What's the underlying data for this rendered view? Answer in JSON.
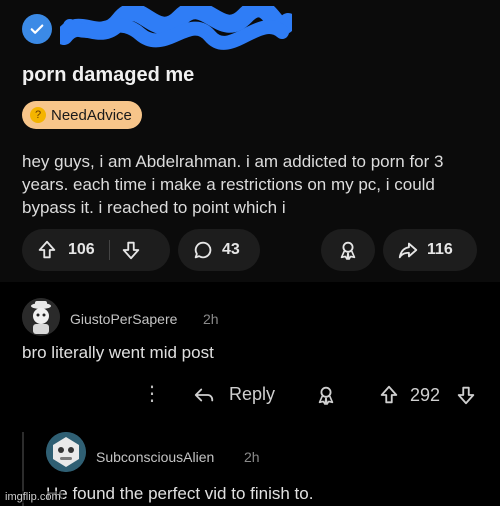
{
  "post": {
    "title": "porn damaged me",
    "flair": "NeedAdvice",
    "body": "hey guys, i am Abdelrahman. i am addicted to porn for 3 years. each time i make a restrictions on my pc, i could bypass it. i reached to point which i",
    "upvotes": "106",
    "comments": "43",
    "shares": "116"
  },
  "comment1": {
    "username": "GiustoPerSapere",
    "time": "2h",
    "text": "bro literally went mid post",
    "reply_label": "Reply",
    "score": "292",
    "more_label": "⋮"
  },
  "comment2": {
    "username": "SubconsciousAlien",
    "time": "2h",
    "text": "He found the perfect vid to finish to."
  },
  "watermark": "imgflip.com",
  "colors": {
    "background": "#000000",
    "post_background": "#0b0b0b",
    "pill": "#1d1d1d",
    "verified": "#3b8ae6",
    "redaction": "#2f7df6",
    "flair": "#f7c58a"
  },
  "icons": [
    "verified-check-icon",
    "upvote-icon",
    "downvote-icon",
    "comment-icon",
    "award-icon",
    "share-icon",
    "more-icon",
    "reply-icon"
  ]
}
